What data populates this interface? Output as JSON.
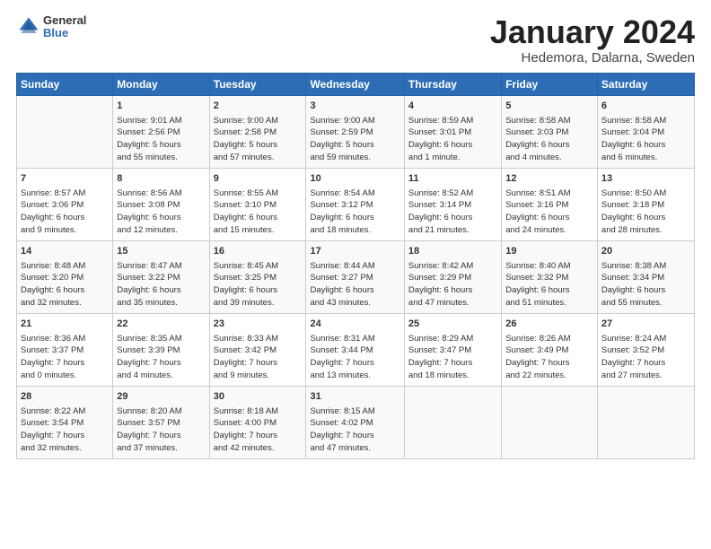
{
  "logo": {
    "general": "General",
    "blue": "Blue"
  },
  "header": {
    "month": "January 2024",
    "location": "Hedemora, Dalarna, Sweden"
  },
  "weekdays": [
    "Sunday",
    "Monday",
    "Tuesday",
    "Wednesday",
    "Thursday",
    "Friday",
    "Saturday"
  ],
  "weeks": [
    [
      {
        "day": "",
        "content": ""
      },
      {
        "day": "1",
        "content": "Sunrise: 9:01 AM\nSunset: 2:56 PM\nDaylight: 5 hours\nand 55 minutes."
      },
      {
        "day": "2",
        "content": "Sunrise: 9:00 AM\nSunset: 2:58 PM\nDaylight: 5 hours\nand 57 minutes."
      },
      {
        "day": "3",
        "content": "Sunrise: 9:00 AM\nSunset: 2:59 PM\nDaylight: 5 hours\nand 59 minutes."
      },
      {
        "day": "4",
        "content": "Sunrise: 8:59 AM\nSunset: 3:01 PM\nDaylight: 6 hours\nand 1 minute."
      },
      {
        "day": "5",
        "content": "Sunrise: 8:58 AM\nSunset: 3:03 PM\nDaylight: 6 hours\nand 4 minutes."
      },
      {
        "day": "6",
        "content": "Sunrise: 8:58 AM\nSunset: 3:04 PM\nDaylight: 6 hours\nand 6 minutes."
      }
    ],
    [
      {
        "day": "7",
        "content": "Sunrise: 8:57 AM\nSunset: 3:06 PM\nDaylight: 6 hours\nand 9 minutes."
      },
      {
        "day": "8",
        "content": "Sunrise: 8:56 AM\nSunset: 3:08 PM\nDaylight: 6 hours\nand 12 minutes."
      },
      {
        "day": "9",
        "content": "Sunrise: 8:55 AM\nSunset: 3:10 PM\nDaylight: 6 hours\nand 15 minutes."
      },
      {
        "day": "10",
        "content": "Sunrise: 8:54 AM\nSunset: 3:12 PM\nDaylight: 6 hours\nand 18 minutes."
      },
      {
        "day": "11",
        "content": "Sunrise: 8:52 AM\nSunset: 3:14 PM\nDaylight: 6 hours\nand 21 minutes."
      },
      {
        "day": "12",
        "content": "Sunrise: 8:51 AM\nSunset: 3:16 PM\nDaylight: 6 hours\nand 24 minutes."
      },
      {
        "day": "13",
        "content": "Sunrise: 8:50 AM\nSunset: 3:18 PM\nDaylight: 6 hours\nand 28 minutes."
      }
    ],
    [
      {
        "day": "14",
        "content": "Sunrise: 8:48 AM\nSunset: 3:20 PM\nDaylight: 6 hours\nand 32 minutes."
      },
      {
        "day": "15",
        "content": "Sunrise: 8:47 AM\nSunset: 3:22 PM\nDaylight: 6 hours\nand 35 minutes."
      },
      {
        "day": "16",
        "content": "Sunrise: 8:45 AM\nSunset: 3:25 PM\nDaylight: 6 hours\nand 39 minutes."
      },
      {
        "day": "17",
        "content": "Sunrise: 8:44 AM\nSunset: 3:27 PM\nDaylight: 6 hours\nand 43 minutes."
      },
      {
        "day": "18",
        "content": "Sunrise: 8:42 AM\nSunset: 3:29 PM\nDaylight: 6 hours\nand 47 minutes."
      },
      {
        "day": "19",
        "content": "Sunrise: 8:40 AM\nSunset: 3:32 PM\nDaylight: 6 hours\nand 51 minutes."
      },
      {
        "day": "20",
        "content": "Sunrise: 8:38 AM\nSunset: 3:34 PM\nDaylight: 6 hours\nand 55 minutes."
      }
    ],
    [
      {
        "day": "21",
        "content": "Sunrise: 8:36 AM\nSunset: 3:37 PM\nDaylight: 7 hours\nand 0 minutes."
      },
      {
        "day": "22",
        "content": "Sunrise: 8:35 AM\nSunset: 3:39 PM\nDaylight: 7 hours\nand 4 minutes."
      },
      {
        "day": "23",
        "content": "Sunrise: 8:33 AM\nSunset: 3:42 PM\nDaylight: 7 hours\nand 9 minutes."
      },
      {
        "day": "24",
        "content": "Sunrise: 8:31 AM\nSunset: 3:44 PM\nDaylight: 7 hours\nand 13 minutes."
      },
      {
        "day": "25",
        "content": "Sunrise: 8:29 AM\nSunset: 3:47 PM\nDaylight: 7 hours\nand 18 minutes."
      },
      {
        "day": "26",
        "content": "Sunrise: 8:26 AM\nSunset: 3:49 PM\nDaylight: 7 hours\nand 22 minutes."
      },
      {
        "day": "27",
        "content": "Sunrise: 8:24 AM\nSunset: 3:52 PM\nDaylight: 7 hours\nand 27 minutes."
      }
    ],
    [
      {
        "day": "28",
        "content": "Sunrise: 8:22 AM\nSunset: 3:54 PM\nDaylight: 7 hours\nand 32 minutes."
      },
      {
        "day": "29",
        "content": "Sunrise: 8:20 AM\nSunset: 3:57 PM\nDaylight: 7 hours\nand 37 minutes."
      },
      {
        "day": "30",
        "content": "Sunrise: 8:18 AM\nSunset: 4:00 PM\nDaylight: 7 hours\nand 42 minutes."
      },
      {
        "day": "31",
        "content": "Sunrise: 8:15 AM\nSunset: 4:02 PM\nDaylight: 7 hours\nand 47 minutes."
      },
      {
        "day": "",
        "content": ""
      },
      {
        "day": "",
        "content": ""
      },
      {
        "day": "",
        "content": ""
      }
    ]
  ]
}
